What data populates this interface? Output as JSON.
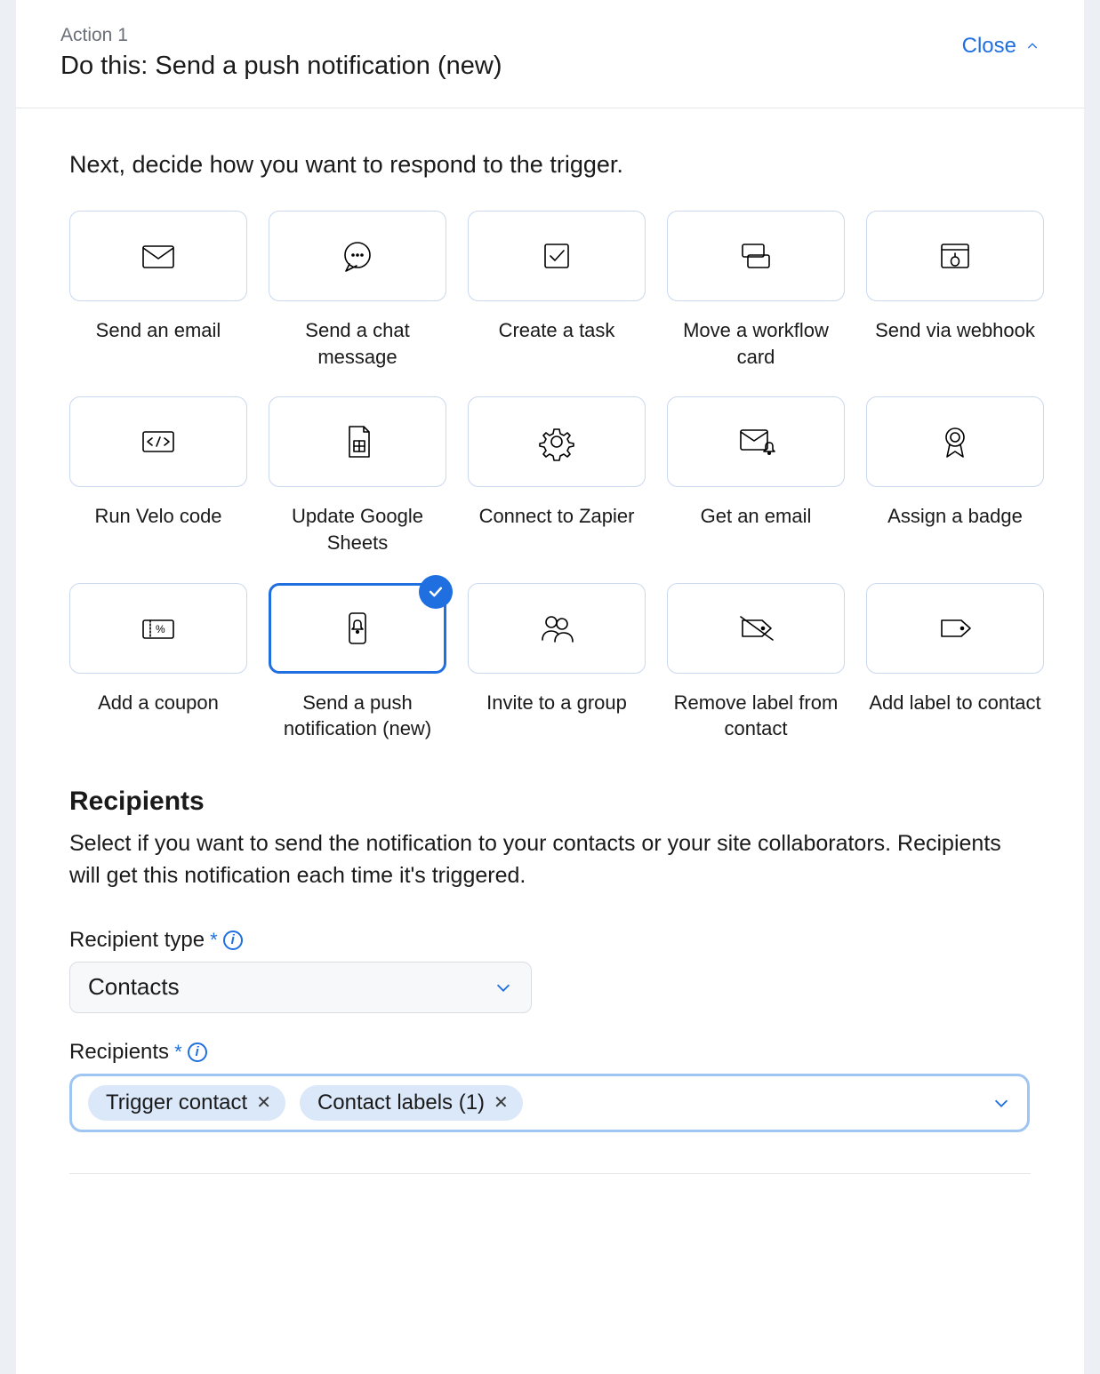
{
  "header": {
    "step_label": "Action 1",
    "title": "Do this: Send a push notification (new)",
    "close_label": "Close"
  },
  "body": {
    "prompt": "Next, decide how you want to respond to the trigger."
  },
  "actions": [
    {
      "id": "send-email",
      "label": "Send an email",
      "icon": "envelope-icon",
      "selected": false
    },
    {
      "id": "send-chat",
      "label": "Send a chat message",
      "icon": "chat-icon",
      "selected": false
    },
    {
      "id": "create-task",
      "label": "Create a task",
      "icon": "check-square-icon",
      "selected": false
    },
    {
      "id": "move-workflow",
      "label": "Move a workflow card",
      "icon": "cards-icon",
      "selected": false
    },
    {
      "id": "send-webhook",
      "label": "Send via webhook",
      "icon": "webhook-icon",
      "selected": false
    },
    {
      "id": "run-velo",
      "label": "Run Velo code",
      "icon": "code-icon",
      "selected": false
    },
    {
      "id": "update-sheets",
      "label": "Update Google Sheets",
      "icon": "sheets-icon",
      "selected": false
    },
    {
      "id": "connect-zapier",
      "label": "Connect to Zapier",
      "icon": "gear-icon",
      "selected": false
    },
    {
      "id": "get-email",
      "label": "Get an email",
      "icon": "envelope-bell-icon",
      "selected": false
    },
    {
      "id": "assign-badge",
      "label": "Assign a badge",
      "icon": "award-icon",
      "selected": false
    },
    {
      "id": "add-coupon",
      "label": "Add a coupon",
      "icon": "coupon-icon",
      "selected": false
    },
    {
      "id": "send-push",
      "label": "Send a push notification (new)",
      "icon": "push-icon",
      "selected": true
    },
    {
      "id": "invite-group",
      "label": "Invite to a group",
      "icon": "group-icon",
      "selected": false
    },
    {
      "id": "remove-label",
      "label": "Remove label from contact",
      "icon": "remove-tag-icon",
      "selected": false
    },
    {
      "id": "add-label",
      "label": "Add label to contact",
      "icon": "add-tag-icon",
      "selected": false
    }
  ],
  "recipients": {
    "section_title": "Recipients",
    "section_desc": "Select if you want to send the notification to your contacts or your site collaborators. Recipients will get this notification each time it's triggered.",
    "type_label": "Recipient type",
    "type_value": "Contacts",
    "recipients_label": "Recipients",
    "chips": [
      "Trigger contact",
      "Contact labels (1)"
    ]
  }
}
